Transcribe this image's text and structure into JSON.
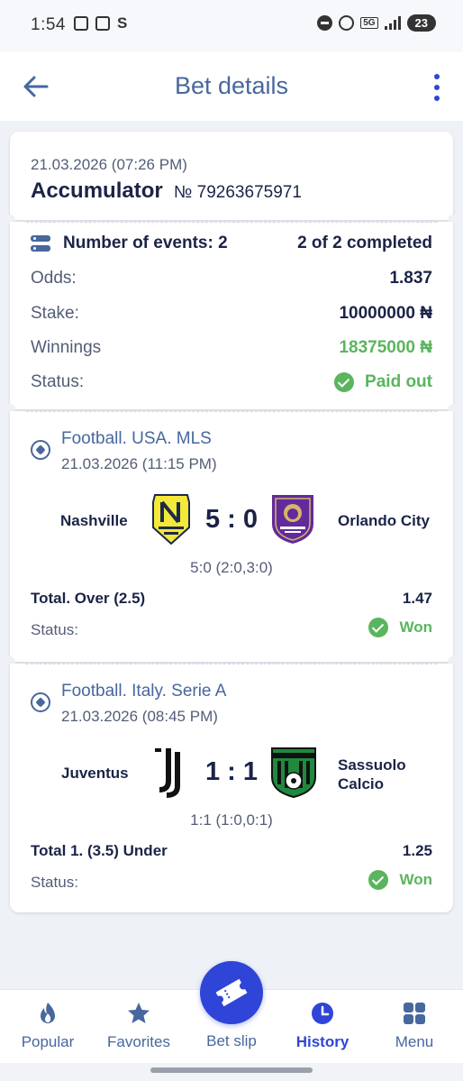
{
  "status_bar": {
    "time": "1:54",
    "network": "5G",
    "battery": "23"
  },
  "header": {
    "title": "Bet details"
  },
  "bet": {
    "datetime": "21.03.2026 (07:26 PM)",
    "type": "Accumulator",
    "number": "№ 79263675971",
    "events_label": "Number of events: 2",
    "events_completed": "2 of 2 completed",
    "odds_label": "Odds:",
    "odds_value": "1.837",
    "stake_label": "Stake:",
    "stake_value": "10000000 ₦",
    "winnings_label": "Winnings",
    "winnings_value": "18375000 ₦",
    "status_label": "Status:",
    "status_value": "Paid out"
  },
  "events": [
    {
      "league": "Football. USA. MLS",
      "datetime": "21.03.2026 (11:15 PM)",
      "home_team": "Nashville",
      "away_team": "Orlando City",
      "score": "5 : 0",
      "halves": "5:0 (2:0,3:0)",
      "market": "Total. Over (2.5)",
      "odd": "1.47",
      "status_label": "Status:",
      "status_value": "Won"
    },
    {
      "league": "Football. Italy. Serie A",
      "datetime": "21.03.2026 (08:45 PM)",
      "home_team": "Juventus",
      "away_team_line1": "Sassuolo",
      "away_team_line2": "Calcio",
      "score": "1 : 1",
      "halves": "1:1 (1:0,0:1)",
      "market": "Total 1. (3.5) Under",
      "odd": "1.25",
      "status_label": "Status:",
      "status_value": "Won"
    }
  ],
  "nav": {
    "popular": "Popular",
    "favorites": "Favorites",
    "bet_slip": "Bet slip",
    "history": "History",
    "menu": "Menu"
  },
  "colors": {
    "accent": "#2f45d8",
    "title_blue": "#47679e",
    "win_green": "#5ab55e",
    "background": "#eef1f6"
  }
}
